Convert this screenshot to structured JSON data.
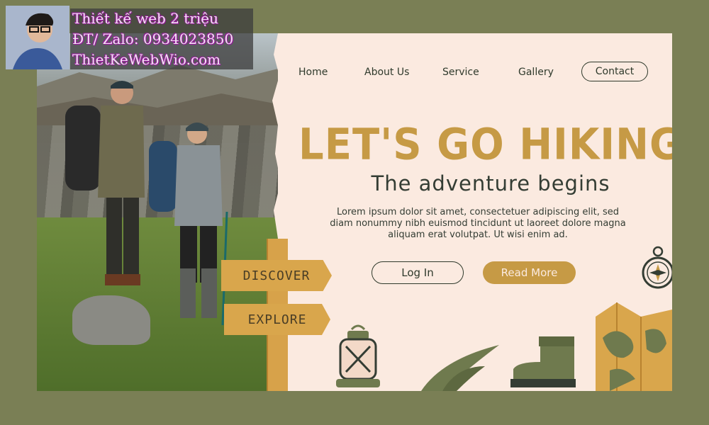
{
  "watermark": {
    "line1": "Thiết kế web 2 triệu",
    "line2": "ĐT/ Zalo: 0934023850",
    "line3": "ThietKeWebWio.com"
  },
  "nav": {
    "items": [
      {
        "label": "Home"
      },
      {
        "label": "About Us"
      },
      {
        "label": "Service"
      },
      {
        "label": "Gallery"
      }
    ],
    "contact_label": "Contact"
  },
  "hero": {
    "headline": "LET'S GO HIKING",
    "subhead": "The adventure begins",
    "body": "Lorem ipsum dolor sit amet, consectetuer adipiscing elit, sed diam nonummy nibh euismod tincidunt ut laoreet dolore magna aliquam erat volutpat. Ut wisi enim ad.",
    "login_label": "Log In",
    "readmore_label": "Read More"
  },
  "signpost": {
    "discover": "DISCOVER",
    "explore": "EXPLORE"
  },
  "colors": {
    "background": "#7a7f55",
    "panel": "#fbeae0",
    "accent": "#c69a45",
    "dark": "#2f3a2c"
  },
  "icons": [
    "compass-icon",
    "lantern-icon",
    "boot-icon",
    "map-icon",
    "leaf-icon"
  ]
}
